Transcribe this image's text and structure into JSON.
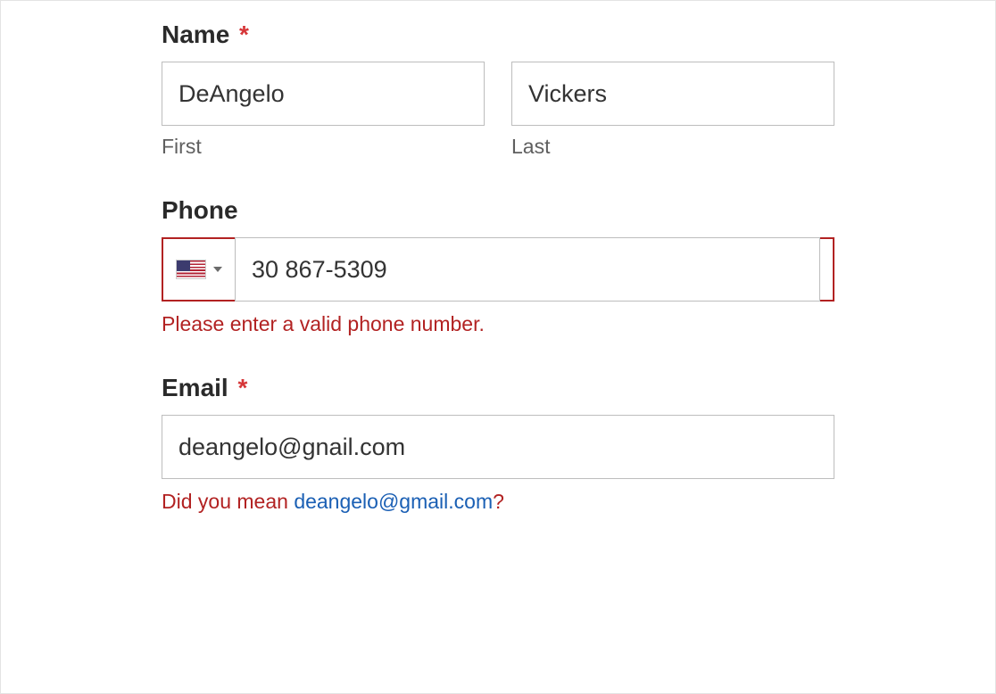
{
  "name": {
    "label": "Name",
    "required_mark": "*",
    "first_value": "DeAngelo",
    "last_value": "Vickers",
    "first_sublabel": "First",
    "last_sublabel": "Last"
  },
  "phone": {
    "label": "Phone",
    "value": "30 867-5309",
    "error": "Please enter a valid phone number.",
    "country_icon": "us-flag-icon"
  },
  "email": {
    "label": "Email",
    "required_mark": "*",
    "value": "deangelo@gnail.com",
    "suggest_prefix": "Did you mean ",
    "suggest_email": "deangelo@gmail.com",
    "suggest_suffix": "?"
  }
}
